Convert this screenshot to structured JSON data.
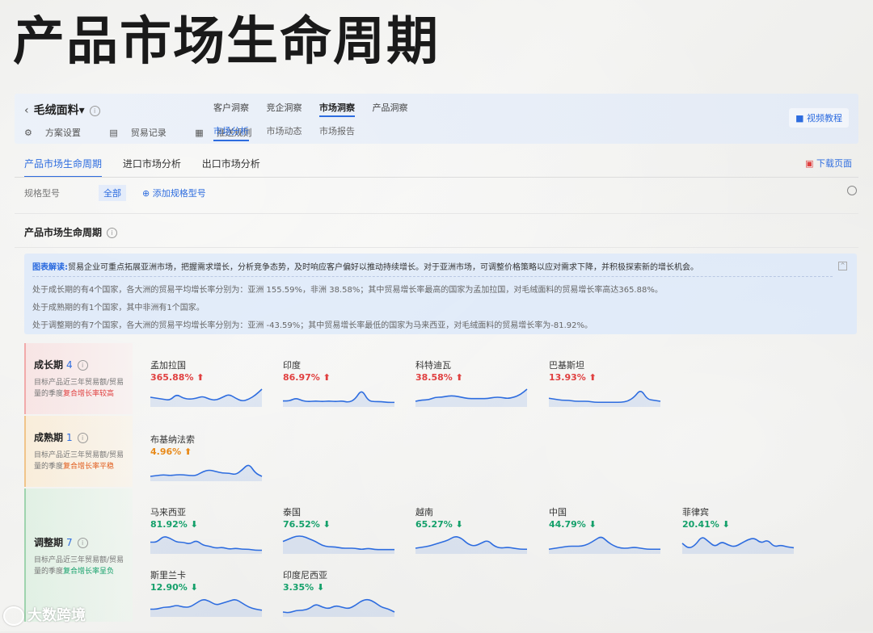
{
  "page_title": "产品市场生命周期",
  "header": {
    "product": "毛绒面料",
    "links": [
      "方案设置",
      "贸易记录",
      "推送规则"
    ],
    "tabs_primary": [
      "客户洞察",
      "竞企洞察",
      "市场洞察",
      "产品洞察"
    ],
    "tabs_secondary": [
      "市场分析",
      "市场动态",
      "市场报告"
    ],
    "video_label": "视频教程"
  },
  "nav": {
    "tabs": [
      "产品市场生命周期",
      "进口市场分析",
      "出口市场分析"
    ],
    "download_label": "下载页面"
  },
  "spec": {
    "label": "规格型号",
    "all": "全部",
    "add": "添加规格型号"
  },
  "section_title": "产品市场生命周期",
  "insight": {
    "label": "图表解读:",
    "line1": "贸易企业可重点拓展亚洲市场，把握需求增长，分析竞争态势，及时响应客户偏好以推动持续增长。对于亚洲市场，可调整价格策略以应对需求下降，并积极探索新的增长机会。",
    "line2": "处于成长期的有4个国家，各大洲的贸易平均增长率分别为：亚洲 155.59%，非洲 38.58%；其中贸易增长率最高的国家为孟加拉国，对毛绒面料的贸易增长率高达365.88%。",
    "line3": "处于成熟期的有1个国家，其中非洲有1个国家。",
    "line4": "处于调整期的有7个国家，各大洲的贸易平均增长率分别为：亚洲 -43.59%；其中贸易增长率最低的国家为马来西亚，对毛绒面料的贸易增长率为-81.92%。"
  },
  "stages": [
    {
      "name": "成长期",
      "count": "4",
      "desc_a": "目标产品近三年贸易额/贸易量的季度",
      "desc_b": "复合增长率较高"
    },
    {
      "name": "成熟期",
      "count": "1",
      "desc_a": "目标产品近三年贸易额/贸易量的季度",
      "desc_b": "复合增长率平稳"
    },
    {
      "name": "调整期",
      "count": "7",
      "desc_a": "目标产品近三年贸易额/贸易量的季度",
      "desc_b": "复合增长率呈负"
    }
  ],
  "countries": [
    {
      "name": "孟加拉国",
      "pct": "365.88%",
      "arrow": "⬆"
    },
    {
      "name": "印度",
      "pct": "86.97%",
      "arrow": "⬆"
    },
    {
      "name": "科特迪瓦",
      "pct": "38.58%",
      "arrow": "⬆"
    },
    {
      "name": "巴基斯坦",
      "pct": "13.93%",
      "arrow": "⬆"
    },
    {
      "name": "布基纳法索",
      "pct": "4.96%",
      "arrow": "⬆"
    },
    {
      "name": "马来西亚",
      "pct": "81.92%",
      "arrow": "⬇"
    },
    {
      "name": "泰国",
      "pct": "76.52%",
      "arrow": "⬇"
    },
    {
      "name": "越南",
      "pct": "65.27%",
      "arrow": "⬇"
    },
    {
      "name": "中国",
      "pct": "44.79%",
      "arrow": "⬇"
    },
    {
      "name": "菲律宾",
      "pct": "20.41%",
      "arrow": "⬇"
    },
    {
      "name": "斯里兰卡",
      "pct": "12.90%",
      "arrow": "⬇"
    },
    {
      "name": "印度尼西亚",
      "pct": "3.35%",
      "arrow": "⬇"
    }
  ],
  "watermark": "大数跨境",
  "colors": {
    "accent": "#2d6cdf",
    "growth": "#e04040",
    "mature": "#e88a1a",
    "adjust": "#14a06a"
  }
}
